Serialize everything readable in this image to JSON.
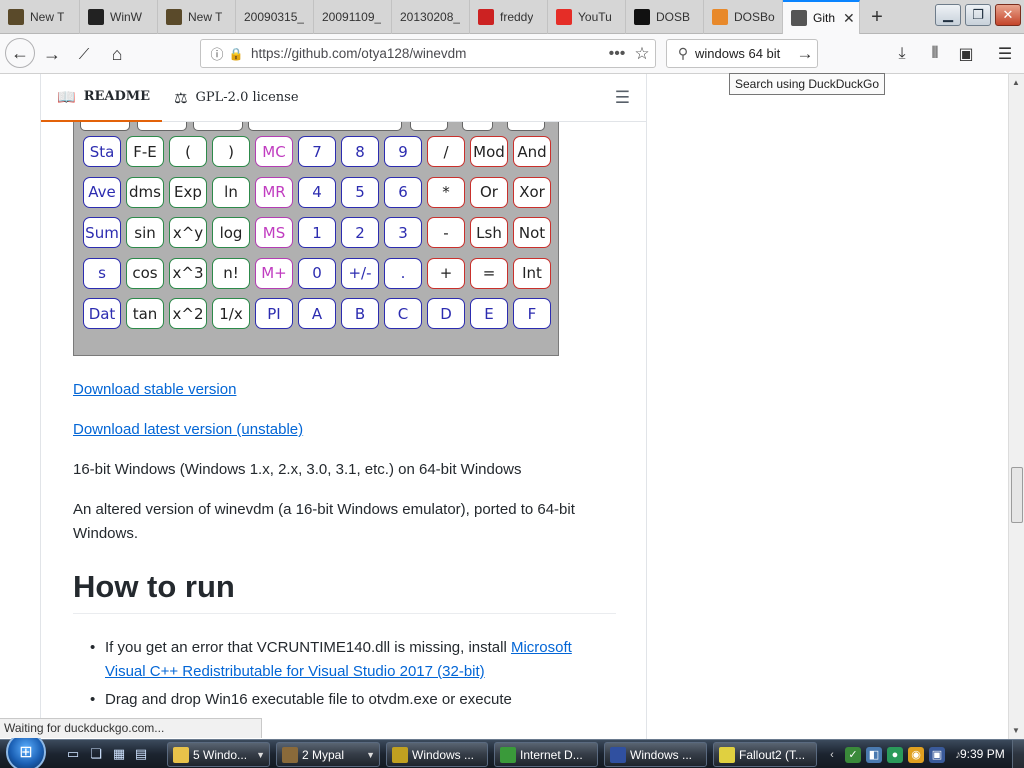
{
  "tabs": [
    {
      "title": "New T",
      "icon": "fallout-icon",
      "color": "#5a4a2a"
    },
    {
      "title": "WinW",
      "icon": "winworld-icon",
      "color": "#222222"
    },
    {
      "title": "New T",
      "icon": "fallout-icon",
      "color": "#5a4a2a"
    },
    {
      "title": "20090315_",
      "icon": "",
      "color": ""
    },
    {
      "title": "20091109_",
      "icon": "",
      "color": ""
    },
    {
      "title": "20130208_",
      "icon": "",
      "color": ""
    },
    {
      "title": "freddy",
      "icon": "opera-icon",
      "color": "#cc2222"
    },
    {
      "title": "YouTu",
      "icon": "youtube-icon",
      "color": "#e52d27"
    },
    {
      "title": "DOSB",
      "icon": "z-icon",
      "color": "#111111"
    },
    {
      "title": "DOSBo",
      "icon": "dosbox-icon",
      "color": "#e8892a"
    },
    {
      "title": "Gith",
      "icon": "github-icon",
      "color": "#555555"
    }
  ],
  "nav": {
    "url": "https://github.com/otya128/winevdm",
    "search_value": "windows 64 bit",
    "tooltip": "Search using DuckDuckGo"
  },
  "readme_header": {
    "readme_label": "README",
    "license_label": "GPL-2.0 license"
  },
  "calculator": {
    "rows": [
      [
        {
          "l": "Sta",
          "c": "h"
        },
        {
          "l": "F-E",
          "c": "g"
        },
        {
          "l": "(",
          "c": "g"
        },
        {
          "l": ")",
          "c": "g"
        },
        {
          "l": "MC",
          "c": "m"
        },
        {
          "l": "7",
          "c": "n"
        },
        {
          "l": "8",
          "c": "n"
        },
        {
          "l": "9",
          "c": "n"
        },
        {
          "l": "/",
          "c": "r"
        },
        {
          "l": "Mod",
          "c": "r"
        },
        {
          "l": "And",
          "c": "r"
        }
      ],
      [
        {
          "l": "Ave",
          "c": "h"
        },
        {
          "l": "dms",
          "c": "g"
        },
        {
          "l": "Exp",
          "c": "g"
        },
        {
          "l": "ln",
          "c": "g"
        },
        {
          "l": "MR",
          "c": "m"
        },
        {
          "l": "4",
          "c": "n"
        },
        {
          "l": "5",
          "c": "n"
        },
        {
          "l": "6",
          "c": "n"
        },
        {
          "l": "*",
          "c": "r"
        },
        {
          "l": "Or",
          "c": "r"
        },
        {
          "l": "Xor",
          "c": "r"
        }
      ],
      [
        {
          "l": "Sum",
          "c": "h"
        },
        {
          "l": "sin",
          "c": "g"
        },
        {
          "l": "x^y",
          "c": "g"
        },
        {
          "l": "log",
          "c": "g"
        },
        {
          "l": "MS",
          "c": "m"
        },
        {
          "l": "1",
          "c": "n"
        },
        {
          "l": "2",
          "c": "n"
        },
        {
          "l": "3",
          "c": "n"
        },
        {
          "l": "-",
          "c": "r"
        },
        {
          "l": "Lsh",
          "c": "r"
        },
        {
          "l": "Not",
          "c": "r"
        }
      ],
      [
        {
          "l": "s",
          "c": "h"
        },
        {
          "l": "cos",
          "c": "g"
        },
        {
          "l": "x^3",
          "c": "g"
        },
        {
          "l": "n!",
          "c": "g"
        },
        {
          "l": "M+",
          "c": "m"
        },
        {
          "l": "0",
          "c": "n"
        },
        {
          "l": "+/-",
          "c": "n"
        },
        {
          "l": ".",
          "c": "n"
        },
        {
          "l": "+",
          "c": "r"
        },
        {
          "l": "=",
          "c": "r"
        },
        {
          "l": "Int",
          "c": "r"
        }
      ],
      [
        {
          "l": "Dat",
          "c": "h"
        },
        {
          "l": "tan",
          "c": "g"
        },
        {
          "l": "x^2",
          "c": "g"
        },
        {
          "l": "1/x",
          "c": "g"
        },
        {
          "l": "PI",
          "c": "h"
        },
        {
          "l": "A",
          "c": "h"
        },
        {
          "l": "B",
          "c": "h"
        },
        {
          "l": "C",
          "c": "h"
        },
        {
          "l": "D",
          "c": "h"
        },
        {
          "l": "E",
          "c": "h"
        },
        {
          "l": "F",
          "c": "h"
        }
      ]
    ]
  },
  "content": {
    "download_stable": "Download stable version",
    "download_latest": "Download latest version (unstable)",
    "para1": "16-bit Windows (Windows 1.x, 2.x, 3.0, 3.1, etc.) on 64-bit Windows",
    "para2": "An altered version of winevdm (a 16-bit Windows emulator), ported to 64-bit Windows.",
    "heading": "How to run",
    "bullet1_text": "If you get an error that VCRUNTIME140.dll is missing, install ",
    "bullet1_link": "Microsoft Visual C++ Redistributable for Visual Studio 2017 (32-bit)",
    "bullet2_text": "Drag and drop Win16 executable file to otvdm.exe or execute"
  },
  "status": "Waiting for duckduckgo.com...",
  "taskbar": {
    "items": [
      {
        "label": "5 Windo...",
        "color": "#e8c24a",
        "dd": true
      },
      {
        "label": "2 Mypal",
        "color": "#8a6a3a",
        "dd": true
      },
      {
        "label": "Windows ...",
        "color": "#c0a020",
        "dd": false
      },
      {
        "label": "Internet D...",
        "color": "#3a9a3a",
        "dd": false
      },
      {
        "label": "Windows ...",
        "color": "#3050a0",
        "dd": false
      },
      {
        "label": "Fallout2 (T...",
        "color": "#e0d040",
        "dd": false
      }
    ],
    "clock": "9:39 PM"
  }
}
